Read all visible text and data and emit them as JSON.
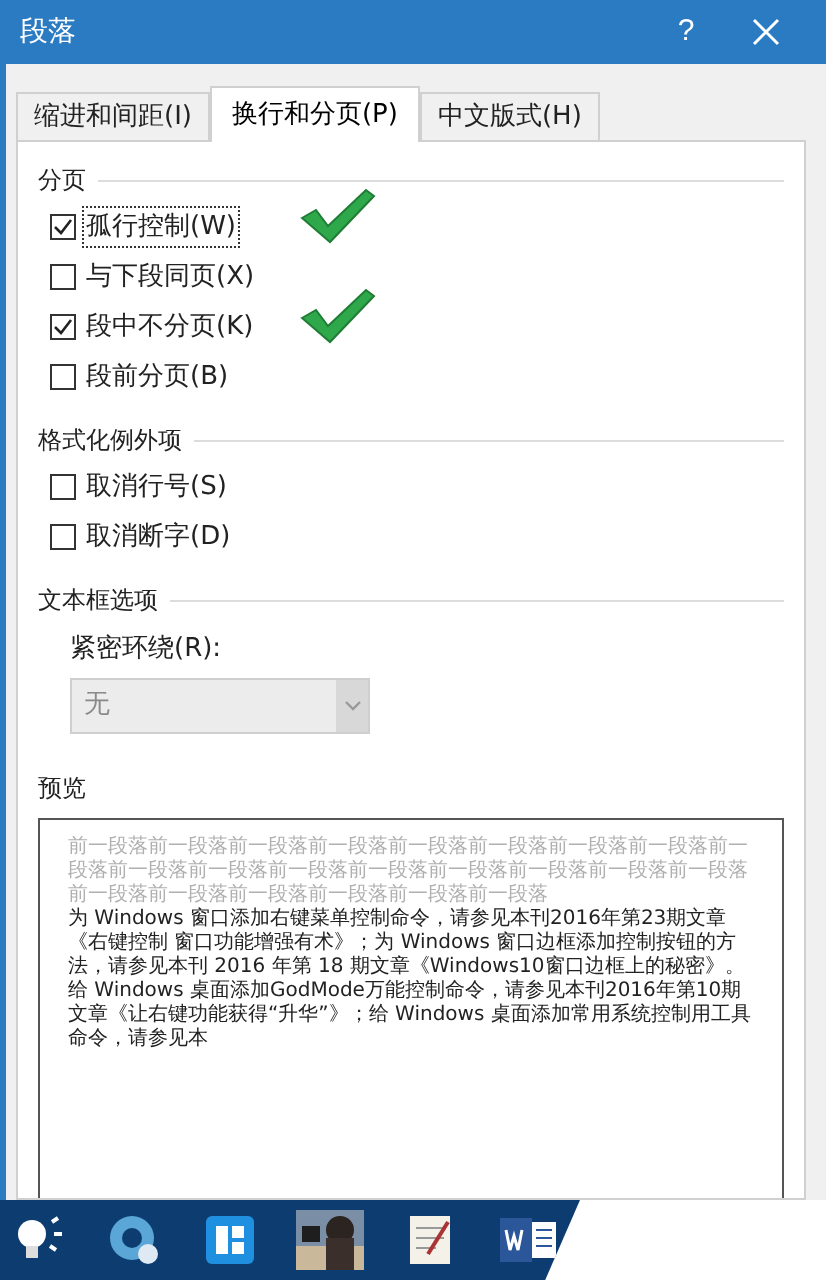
{
  "window": {
    "title": "段落",
    "help": "?"
  },
  "tabs": [
    {
      "label": "缩进和间距(I)",
      "selected": false
    },
    {
      "label": "换行和分页(P)",
      "selected": true
    },
    {
      "label": "中文版式(H)",
      "selected": false
    }
  ],
  "groups": [
    {
      "title": "分页",
      "options": [
        {
          "label": "孤行控制(W)",
          "checked": true,
          "focused": true,
          "marked": true
        },
        {
          "label": "与下段同页(X)",
          "checked": false,
          "focused": false,
          "marked": false
        },
        {
          "label": "段中不分页(K)",
          "checked": true,
          "focused": false,
          "marked": true
        },
        {
          "label": "段前分页(B)",
          "checked": false,
          "focused": false,
          "marked": false
        }
      ]
    },
    {
      "title": "格式化例外项",
      "options": [
        {
          "label": "取消行号(S)",
          "checked": false,
          "focused": false,
          "marked": false
        },
        {
          "label": "取消断字(D)",
          "checked": false,
          "focused": false,
          "marked": false
        }
      ]
    }
  ],
  "textbox": {
    "title": "文本框选项",
    "label": "紧密环绕(R):",
    "value": "无",
    "disabled": true
  },
  "preview": {
    "title": "预览",
    "before_text": "前一段落前一段落前一段落前一段落前一段落前一段落前一段落前一段落前一段落前一段落前一段落前一段落前一段落前一段落前一段落前一段落前一段落前一段落前一段落前一段落前一段落前一段落前一段落",
    "body_text": "为 Windows 窗口添加右键菜单控制命令，请参见本刊2016年第23期文章《右键控制 窗口功能增强有术》；为 Windows 窗口边框添加控制按钮的方法，请参见本刊 2016 年第 18 期文章《Windows10窗口边框上的秘密》。给 Windows 桌面添加GodMode万能控制命令，请参见本刊2016年第10期文章《让右键功能获得“升华”》；给 Windows 桌面添加常用系统控制用工具命令，请参见本"
  },
  "taskbar": [
    {
      "kind": "bulb"
    },
    {
      "kind": "disc"
    },
    {
      "kind": "app"
    },
    {
      "kind": "picture"
    },
    {
      "kind": "notepad"
    },
    {
      "kind": "word"
    }
  ]
}
